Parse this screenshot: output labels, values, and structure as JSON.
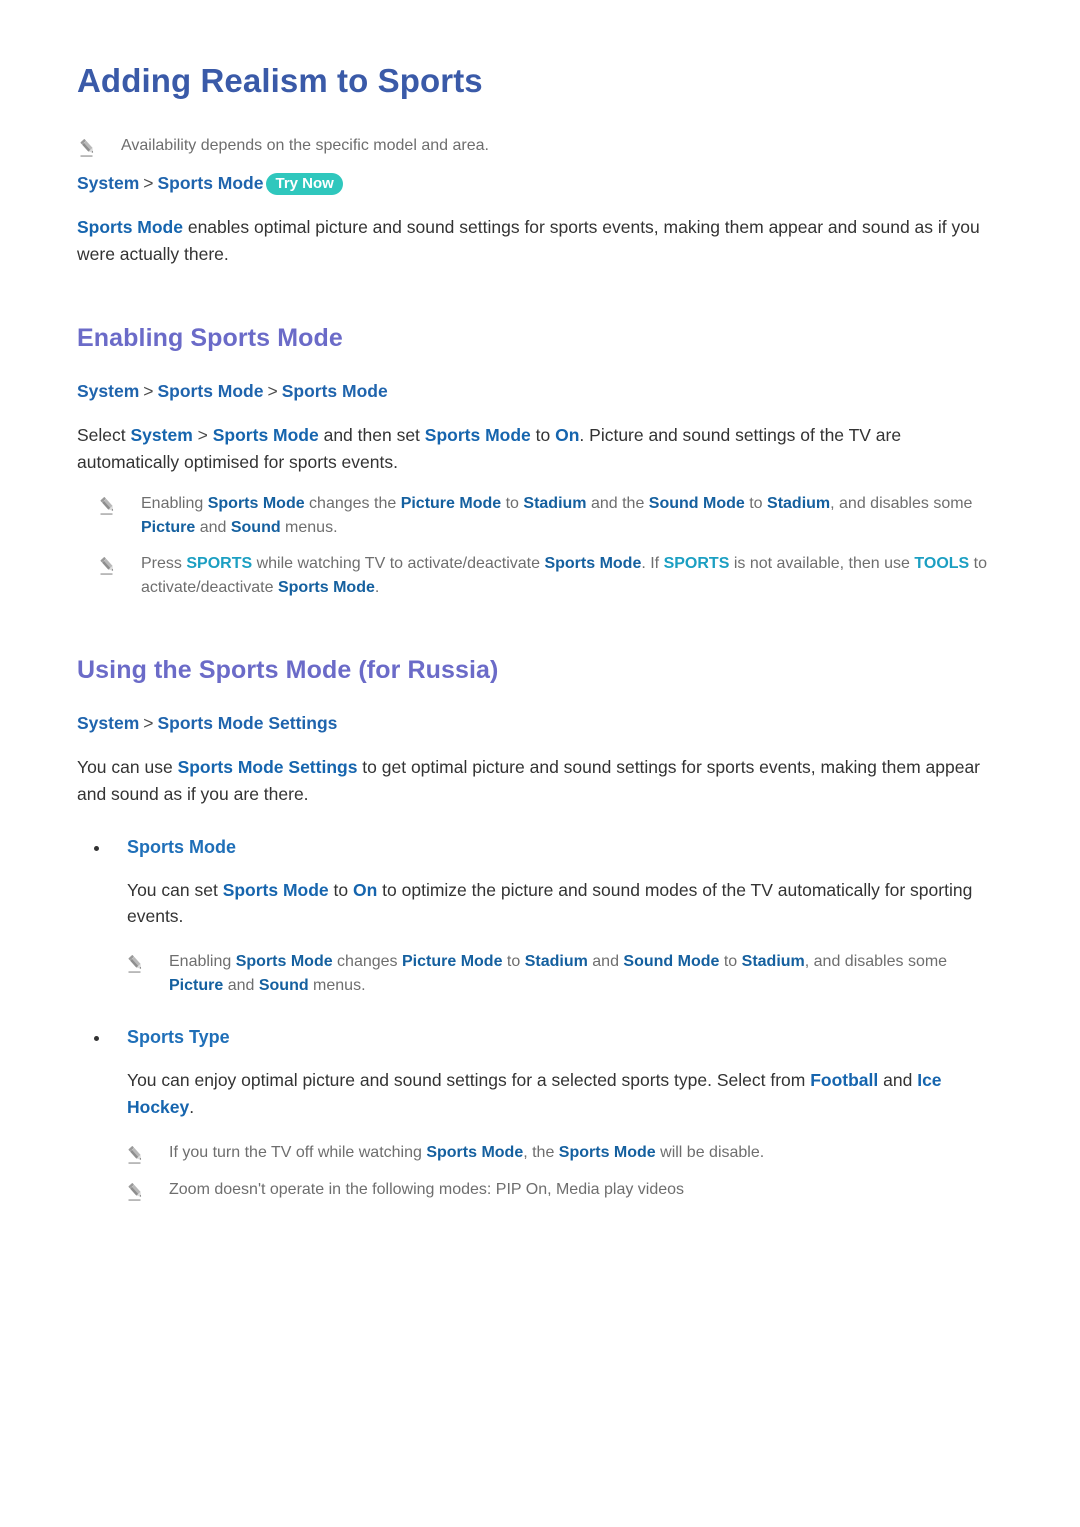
{
  "document": {
    "title": "Adding Realism to Sports"
  },
  "intro": {
    "note": "Availability depends on the specific model and area.",
    "breadcrumb": {
      "part1": "System",
      "sep": ">",
      "part2": "Sports Mode",
      "badge": "Try Now"
    },
    "paragraph": {
      "term": "Sports Mode",
      "rest": " enables optimal picture and sound settings for sports events, making them appear and sound as if you were actually there."
    }
  },
  "section_enabling": {
    "heading": "Enabling Sports Mode",
    "breadcrumb": {
      "part1": "System",
      "sep1": ">",
      "part2": "Sports Mode",
      "sep2": ">",
      "part3": "Sports Mode"
    },
    "paragraph": {
      "t1": "Select ",
      "e1": "System",
      "t2": " ",
      "sep": ">",
      "t3": " ",
      "e2": "Sports Mode",
      "t4": " and then set ",
      "e3": "Sports Mode",
      "t5": " to ",
      "e4": "On",
      "t6": ". Picture and sound settings of the TV are automatically optimised for sports events."
    },
    "notes": [
      {
        "t1": "Enabling ",
        "e1": "Sports Mode",
        "t2": " changes the ",
        "e2": "Picture Mode",
        "t3": " to ",
        "e3": "Stadium",
        "t4": " and the ",
        "e4": "Sound Mode",
        "t5": " to ",
        "e5": "Stadium",
        "t6": ", and disables some ",
        "e6": "Picture",
        "t7": " and ",
        "e7": "Sound",
        "t8": " menus."
      },
      {
        "t1": "Press ",
        "k1": "SPORTS",
        "t2": " while watching TV to activate/deactivate ",
        "e1": "Sports Mode",
        "t3": ". If ",
        "k2": "SPORTS",
        "t4": " is not available, then use ",
        "k3": "TOOLS",
        "t5": " to activate/deactivate ",
        "e2": "Sports Mode",
        "t6": "."
      }
    ]
  },
  "section_russia": {
    "heading": "Using the Sports Mode (for Russia)",
    "breadcrumb": {
      "part1": "System",
      "sep": ">",
      "part2": "Sports Mode Settings"
    },
    "paragraph": {
      "t1": "You can use ",
      "e1": "Sports Mode Settings",
      "t2": " to get optimal picture and sound settings for sports events, making them appear and sound as if you are there."
    },
    "items": [
      {
        "label": "Sports Mode",
        "body": {
          "t1": "You can set ",
          "e1": "Sports Mode",
          "t2": " to ",
          "e2": "On",
          "t3": " to optimize the picture and sound modes of the TV automatically for sporting events."
        },
        "note": {
          "t1": "Enabling ",
          "e1": "Sports Mode",
          "t2": " changes ",
          "e2": "Picture Mode",
          "t3": " to ",
          "e3": "Stadium",
          "t4": " and ",
          "e4": "Sound Mode",
          "t5": " to ",
          "e5": "Stadium",
          "t6": ", and disables some ",
          "e6": "Picture",
          "t7": " and ",
          "e7": "Sound",
          "t8": " menus."
        }
      },
      {
        "label": "Sports Type",
        "body": {
          "t1": "You can enjoy optimal picture and sound settings for a selected sports type. Select from ",
          "e1": "Football",
          "t2": " and ",
          "e2": "Ice Hockey",
          "t3": "."
        }
      }
    ],
    "final_notes": [
      {
        "t1": "If you turn the TV off while watching ",
        "e1": "Sports Mode",
        "t2": ", the ",
        "e2": "Sports Mode",
        "t3": " will be disable."
      },
      {
        "t1": "Zoom doesn't operate in the following modes: PIP On, Media play videos"
      }
    ]
  },
  "colors": {
    "doc_title": "#3a5aa8",
    "section_title": "#6b6bc8",
    "link_blue": "#1665ae",
    "key_cyan": "#1b9fc2",
    "badge_teal": "#2fc7bd",
    "note_gray": "#6e6e6e",
    "body_text": "#333333"
  },
  "icons": {
    "note": "pencil-icon",
    "bullet": "bullet-dot-icon"
  }
}
